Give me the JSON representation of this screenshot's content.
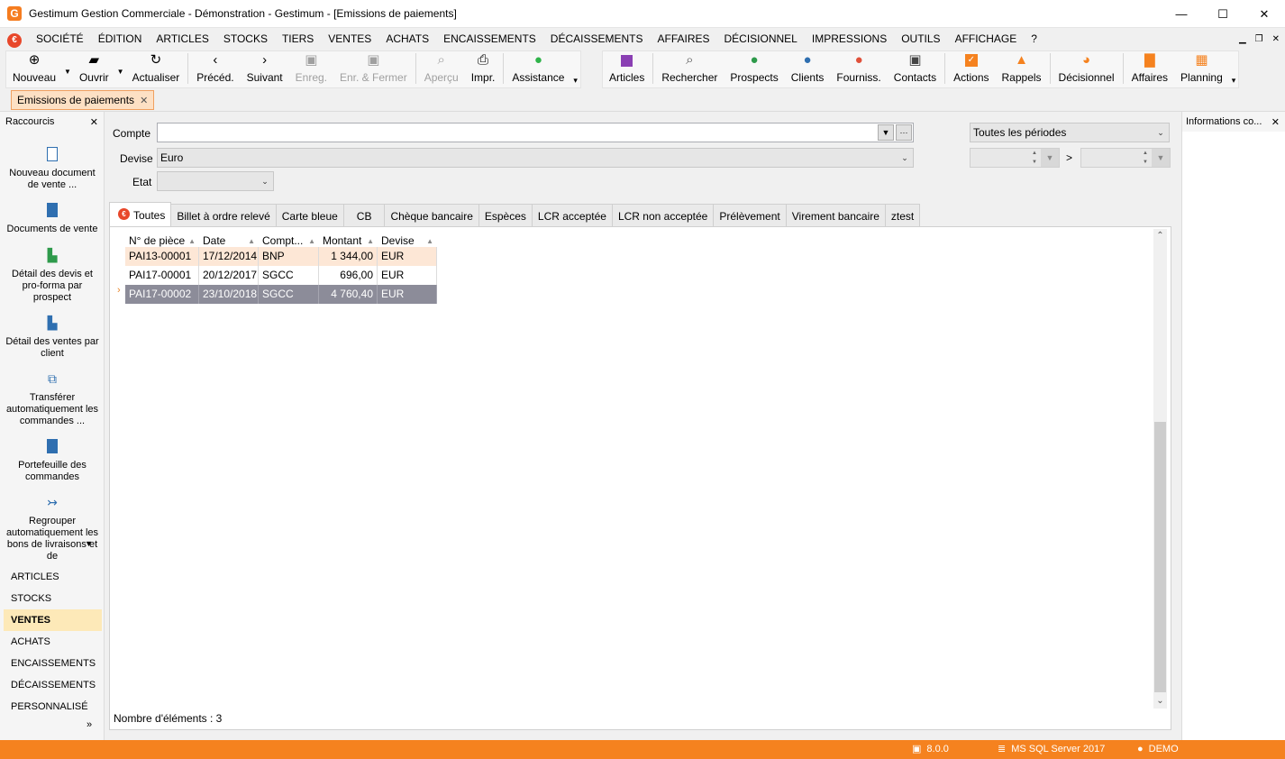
{
  "window": {
    "logo_letter": "G",
    "title": "Gestimum Gestion Commerciale - Démonstration - Gestimum - [Emissions de paiements]",
    "minimize": "—",
    "maximize": "☐",
    "close": "✕"
  },
  "menu": {
    "logo_symbol": "€",
    "items": [
      "SOCIÉTÉ",
      "ÉDITION",
      "ARTICLES",
      "STOCKS",
      "TIERS",
      "VENTES",
      "ACHATS",
      "ENCAISSEMENTS",
      "DÉCAISSEMENTS",
      "AFFAIRES",
      "DÉCISIONNEL",
      "IMPRESSIONS",
      "OUTILS",
      "AFFICHAGE",
      "?"
    ]
  },
  "toolbar1": {
    "nouveau": "Nouveau",
    "ouvrir": "Ouvrir",
    "actualiser": "Actualiser",
    "preced": "Précéd.",
    "suivant": "Suivant",
    "enreg": "Enreg.",
    "enr_fermer": "Enr. & Fermer",
    "apercu": "Aperçu",
    "impr": "Impr.",
    "assistance": "Assistance"
  },
  "toolbar2": {
    "articles": "Articles",
    "rechercher": "Rechercher",
    "prospects": "Prospects",
    "clients": "Clients",
    "fourniss": "Fourniss.",
    "contacts": "Contacts",
    "actions": "Actions",
    "rappels": "Rappels",
    "decisionnel": "Décisionnel",
    "affaires": "Affaires",
    "planning": "Planning"
  },
  "doc_tab": {
    "label": "Emissions de paiements"
  },
  "left_panel": {
    "title": "Raccourcis",
    "shortcuts": [
      "Nouveau document de vente ...",
      "Documents de vente",
      "Détail des devis et pro-forma par prospect",
      "Détail des ventes par client",
      "Transférer automatiquement les commandes ...",
      "Portefeuille des commandes",
      "Regrouper automatiquement les bons de livraisons et de"
    ],
    "nav": [
      "ARTICLES",
      "STOCKS",
      "VENTES",
      "ACHATS",
      "ENCAISSEMENTS",
      "DÉCAISSEMENTS",
      "PERSONNALISÉ"
    ],
    "more": "»"
  },
  "filters": {
    "compte_label": "Compte",
    "compte_value": "",
    "compte_more": "···",
    "devise_label": "Devise",
    "devise_value": "Euro",
    "etat_label": "Etat",
    "etat_value": "",
    "periode_value": "Toutes les périodes",
    "range_sep": ">"
  },
  "payment_tabs": [
    "Toutes",
    "Billet à ordre relevé",
    "Carte bleue",
    "CB",
    "Chèque bancaire",
    "Espèces",
    "LCR acceptée",
    "LCR non acceptée",
    "Prélèvement",
    "Virement bancaire",
    "ztest"
  ],
  "grid": {
    "columns": [
      "N° de pièce",
      "Date",
      "Compt...",
      "Montant",
      "Devise"
    ],
    "rows": [
      [
        "PAI13-00001",
        "17/12/2014",
        "BNP",
        "1 344,00",
        "EUR"
      ],
      [
        "PAI17-00001",
        "20/12/2017",
        "SGCC",
        "696,00",
        "EUR"
      ],
      [
        "PAI17-00002",
        "23/10/2018",
        "SGCC",
        "4 760,40",
        "EUR"
      ]
    ],
    "row_indicator": "›",
    "count_text": "Nombre d'éléments : 3"
  },
  "right_panel": {
    "title": "Informations co..."
  },
  "status": {
    "version": "8.0.0",
    "server": "MS SQL Server 2017",
    "user": "DEMO"
  },
  "colors": {
    "accent": "#f5821f",
    "selected_row": "#8c8c99",
    "highlight_row": "#fde7d6"
  }
}
